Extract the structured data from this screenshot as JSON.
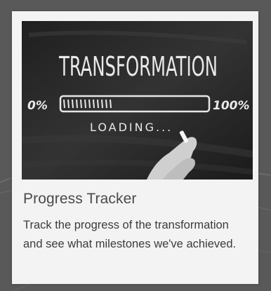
{
  "card": {
    "title": "Progress Tracker",
    "description": "Track the progress of the transformation and see what milestones we've achieved."
  },
  "image": {
    "heading": "TRANSFORMATION",
    "min_label": "0%",
    "max_label": "100%",
    "status": "LOADING...",
    "progress_fraction": 0.35
  },
  "colors": {
    "background": "#595959",
    "card": "#f3f3f3",
    "chalkboard": "#2a2a2a",
    "chalk": "#e9e9e9"
  }
}
